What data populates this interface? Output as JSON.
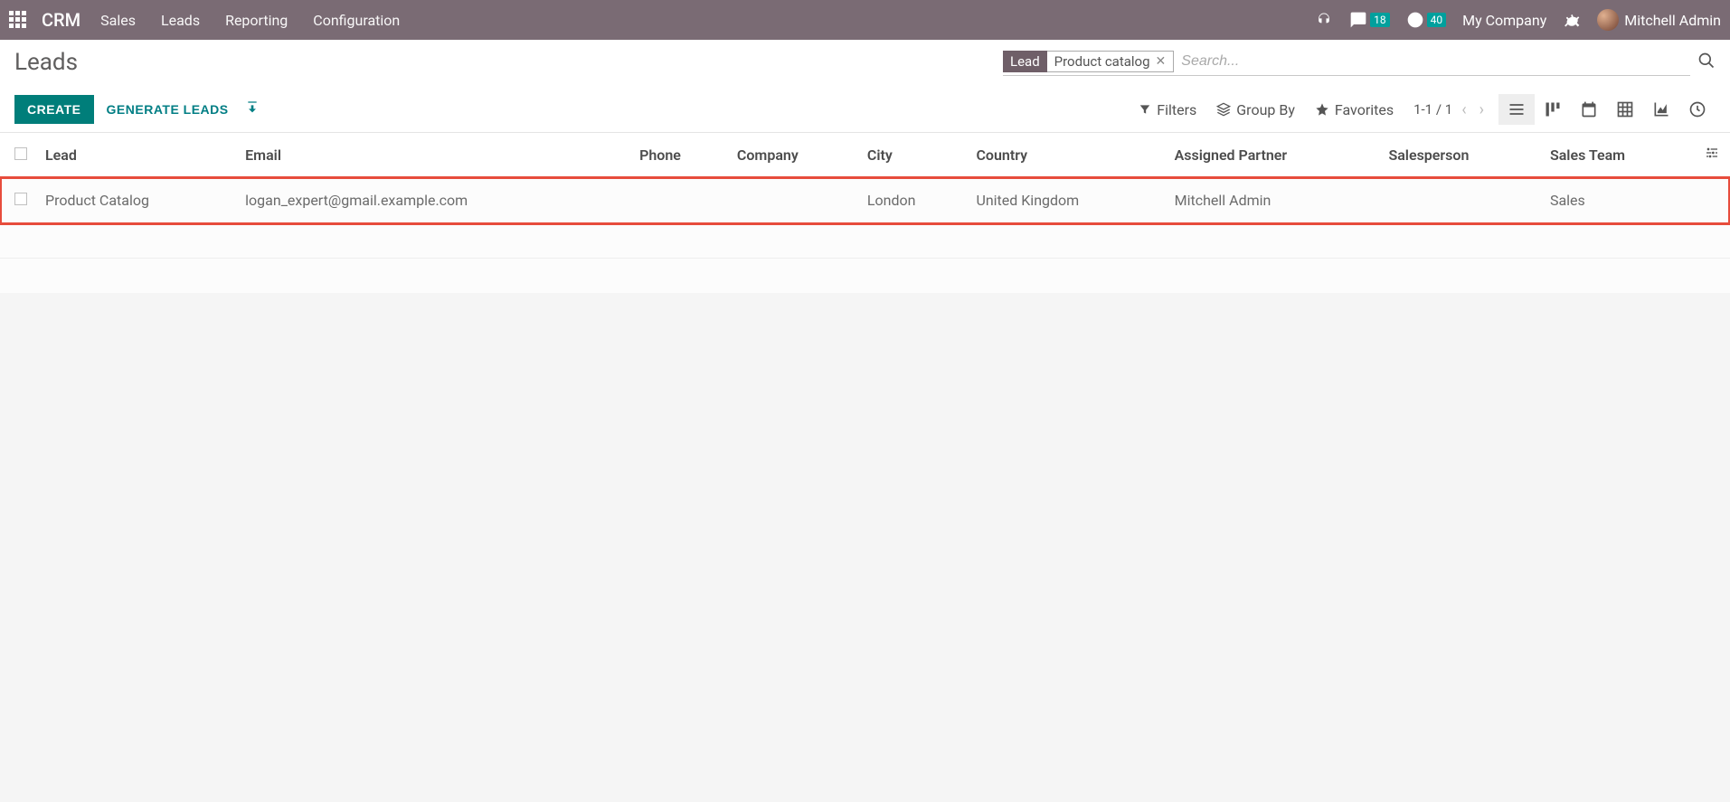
{
  "nav": {
    "brand": "CRM",
    "menus": [
      "Sales",
      "Leads",
      "Reporting",
      "Configuration"
    ],
    "messages_badge": "18",
    "activities_badge": "40",
    "company": "My Company",
    "user": "Mitchell Admin"
  },
  "control": {
    "breadcrumb": "Leads",
    "create_label": "CREATE",
    "generate_label": "GENERATE LEADS",
    "search_facet_key": "Lead",
    "search_facet_val": "Product catalog",
    "search_placeholder": "Search...",
    "filters_label": "Filters",
    "groupby_label": "Group By",
    "favorites_label": "Favorites",
    "pager": "1-1 / 1"
  },
  "columns": {
    "c0": "Lead",
    "c1": "Email",
    "c2": "Phone",
    "c3": "Company",
    "c4": "City",
    "c5": "Country",
    "c6": "Assigned Partner",
    "c7": "Salesperson",
    "c8": "Sales Team"
  },
  "rows": [
    {
      "lead": "Product Catalog",
      "email": "logan_expert@gmail.example.com",
      "phone": "",
      "company": "",
      "city": "London",
      "country": "United Kingdom",
      "assigned_partner": "Mitchell Admin",
      "salesperson": "",
      "sales_team": "Sales"
    }
  ]
}
